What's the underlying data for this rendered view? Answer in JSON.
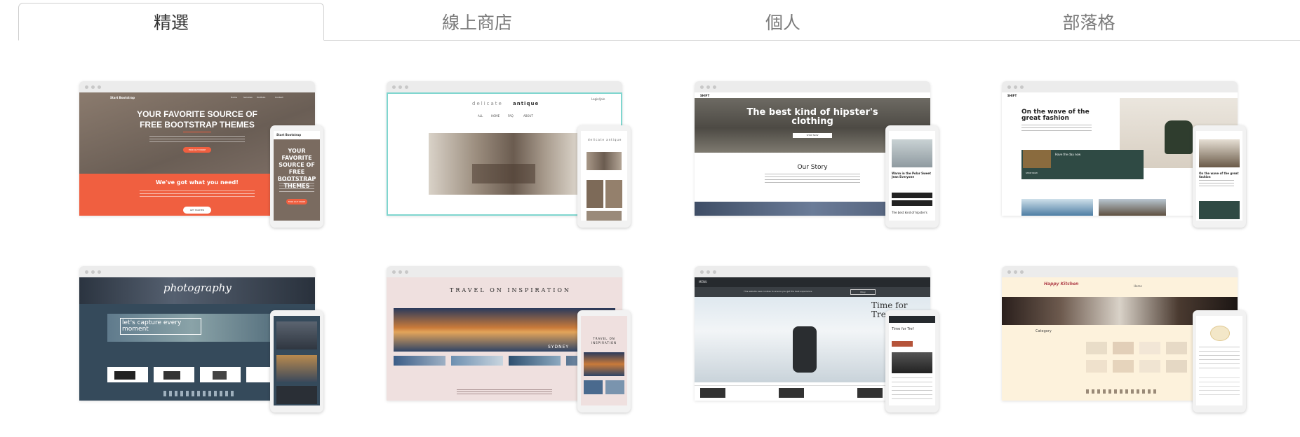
{
  "tabs": [
    {
      "label": "精選",
      "active": true
    },
    {
      "label": "線上商店",
      "active": false
    },
    {
      "label": "個人",
      "active": false
    },
    {
      "label": "部落格",
      "active": false
    }
  ],
  "colors": {
    "active_tab_text": "#333333",
    "inactive_tab_text": "#7b7b7b",
    "tab_border": "#cfcfcf",
    "card1_orange": "#f05f40",
    "card2_teal": "#7fd6cf",
    "card4_green": "#2f4a44",
    "card5_slate": "#354a5b",
    "card6_pink": "#efe0df",
    "card8_cream": "#fdf2dc"
  },
  "templates": [
    {
      "nav_brand": "Start Bootstrap",
      "nav_links": [
        "Home",
        "Services",
        "Portfolio",
        "Contact"
      ],
      "headline": "YOUR FAVORITE SOURCE OF FREE BOOTSTRAP THEMES",
      "button": "FIND OUT MORE",
      "section_title": "We've got what you need!",
      "section_button": "GET STARTED",
      "mobile_brand": "Start Bootstrap",
      "mobile_headline": "YOUR FAVORITE SOURCE OF FREE BOOTSTRAP THEMES",
      "mobile_button": "FIND OUT MORE"
    },
    {
      "logo_light": "delicate",
      "logo_bold": "antique",
      "nav_links": [
        "ALL",
        "HOME",
        "FAQ",
        "ABOUT"
      ],
      "login": "Login/Join",
      "mobile_logo": "delicate antique"
    },
    {
      "brand": "SHIFT",
      "headline": "The best kind of hipster's clothing",
      "button": "SHOP NOW",
      "story_title": "Our Story",
      "mobile_caption": "Warm in the Polar Sweet Jean Everyone",
      "mobile_footer": "The best kind of hipster's"
    },
    {
      "brand": "SHIFT",
      "headline": "On the wave of the great fashion",
      "dark_block": "Have the day now",
      "dark_button": "SHOP NOW",
      "mobile_caption": "On the wave of the great fashion"
    },
    {
      "script_logo": "photography",
      "hero_text": "let's capture every moment"
    },
    {
      "headline": "TRAVEL ON INSPIRATION",
      "caption": "SYDNEY",
      "mobile_headline": "TRAVEL ON INSPIRATION"
    },
    {
      "menu": "MENU",
      "cookie_text": "This website uses cookies to ensure you get the best experience.",
      "cookie_button": "Okay",
      "headline": "Time for Tref",
      "mobile_headline": "Time for Tref"
    },
    {
      "logo": "Happy Kitchen",
      "nav": "Home",
      "category": "Category"
    }
  ]
}
